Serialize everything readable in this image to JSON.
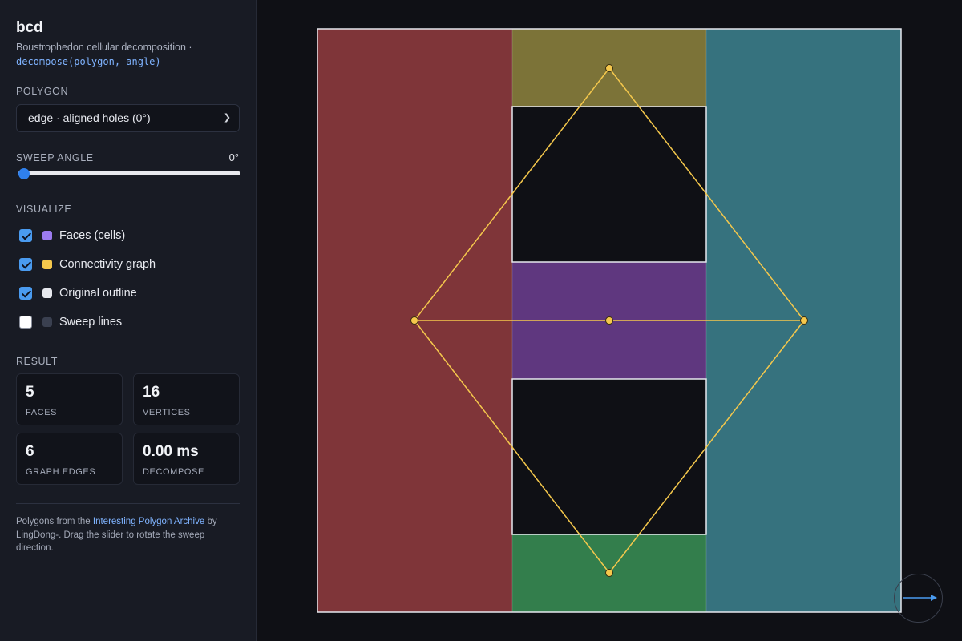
{
  "app": {
    "title": "bcd",
    "subtitle_text": "Boustrophedon cellular decomposition ·",
    "subtitle_code": "decompose(polygon, angle)"
  },
  "polygon": {
    "section_label": "POLYGON",
    "selected": "edge · aligned holes (0°)"
  },
  "sweep": {
    "section_label": "SWEEP ANGLE",
    "value_label": "0°",
    "angle": 0,
    "min": 0,
    "max": 180
  },
  "visualize": {
    "section_label": "VISUALIZE",
    "options": [
      {
        "label": "Faces (cells)",
        "checked": true,
        "swatch": "#9b7bf0"
      },
      {
        "label": "Connectivity graph",
        "checked": true,
        "swatch": "#f5c84c"
      },
      {
        "label": "Original outline",
        "checked": true,
        "swatch": "#e6e8ee"
      },
      {
        "label": "Sweep lines",
        "checked": false,
        "swatch": "#3a4050"
      }
    ]
  },
  "result": {
    "section_label": "RESULT",
    "stats": [
      {
        "value": "5",
        "label": "FACES"
      },
      {
        "value": "16",
        "label": "VERTICES"
      },
      {
        "value": "6",
        "label": "GRAPH EDGES"
      },
      {
        "value": "0.00 ms",
        "label": "DECOMPOSE"
      }
    ]
  },
  "footer": {
    "prefix": "Polygons from the ",
    "link": "Interesting Polygon Archive",
    "suffix": " by LingDong-. Drag the slider to rotate the sweep direction."
  },
  "colors": {
    "face_left": "#7f3539",
    "face_top": "#7c7338",
    "face_middle": "#5f377f",
    "face_bottom": "#337e4c",
    "face_right": "#36727e",
    "hole": "#0f1015",
    "outline": "#e6e8ee",
    "graph": "#f5c84c",
    "accent": "#4a9bf0"
  },
  "compass_icon": "arrow-right-icon"
}
